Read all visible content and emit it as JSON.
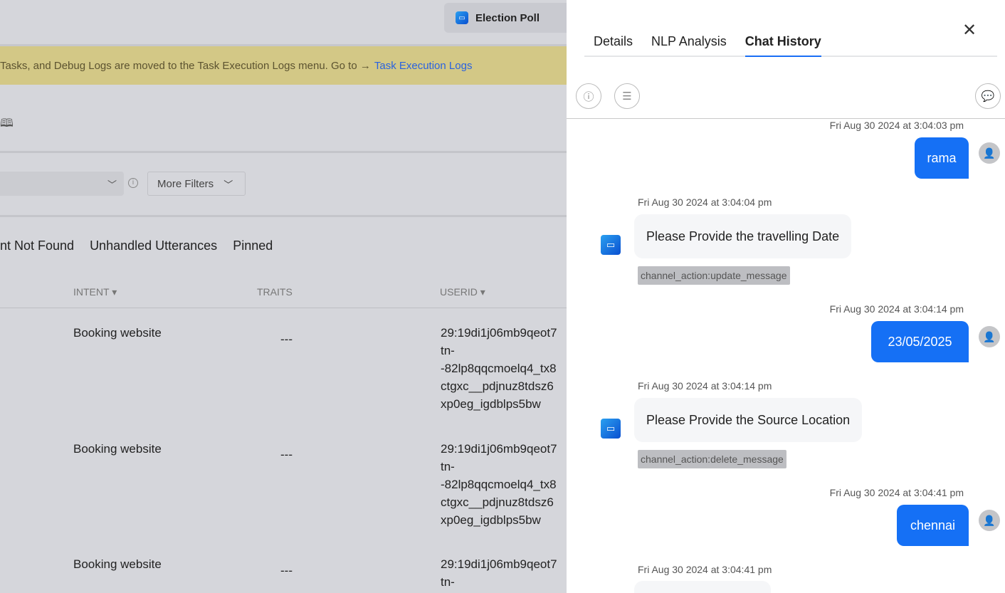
{
  "header": {
    "app_name": "Election Poll"
  },
  "banner": {
    "text": "Tasks, and Debug Logs are moved to the Task Execution Logs menu. Go to →",
    "link": "Task Execution Logs"
  },
  "filters": {
    "more_filters": "More Filters",
    "info": "i"
  },
  "tabs": [
    "nt Not Found",
    "Unhandled Utterances",
    "Pinned"
  ],
  "table": {
    "headers": {
      "intent": "INTENT ▾",
      "traits": "TRAITS",
      "userid": "USERID ▾"
    },
    "rows": [
      {
        "intent": "Booking website",
        "traits": "---",
        "userid": [
          "29:19di1j06mb9qeot7",
          "tn-",
          "-82lp8qqcmoelq4_tx8",
          "ctgxc__pdjnuz8tdsz6",
          "xp0eg_igdblps5bw"
        ]
      },
      {
        "intent": "Booking website",
        "traits": "---",
        "userid": [
          "29:19di1j06mb9qeot7",
          "tn-",
          "-82lp8qqcmoelq4_tx8",
          "ctgxc__pdjnuz8tdsz6",
          "xp0eg_igdblps5bw"
        ]
      },
      {
        "intent": "Booking website",
        "traits": "---",
        "userid": [
          "29:19di1j06mb9qeot7",
          "tn-"
        ]
      }
    ]
  },
  "panel": {
    "tabs": [
      "Details",
      "NLP Analysis",
      "Chat History"
    ],
    "active_tab": "Chat History",
    "close": "✕",
    "messages": [
      {
        "from": "user",
        "time": "Fri Aug 30 2024 at 3:04:03 pm",
        "text": "rama"
      },
      {
        "from": "bot",
        "time": "Fri Aug 30 2024 at 3:04:04 pm",
        "text": "Please Provide the travelling Date",
        "tag": "channel_action:update_message"
      },
      {
        "from": "user",
        "time": "Fri Aug 30 2024 at 3:04:14 pm",
        "text": "23/05/2025"
      },
      {
        "from": "bot",
        "time": "Fri Aug 30 2024 at 3:04:14 pm",
        "text": "Please Provide the Source Location",
        "tag": "channel_action:delete_message"
      },
      {
        "from": "user",
        "time": "Fri Aug 30 2024 at 3:04:41 pm",
        "text": "chennai"
      },
      {
        "from": "bot",
        "time": "Fri Aug 30 2024 at 3:04:41 pm",
        "text": ""
      }
    ]
  },
  "colors": {
    "accent": "#1570f5",
    "banner": "#d3c886",
    "link": "#2962e0"
  }
}
